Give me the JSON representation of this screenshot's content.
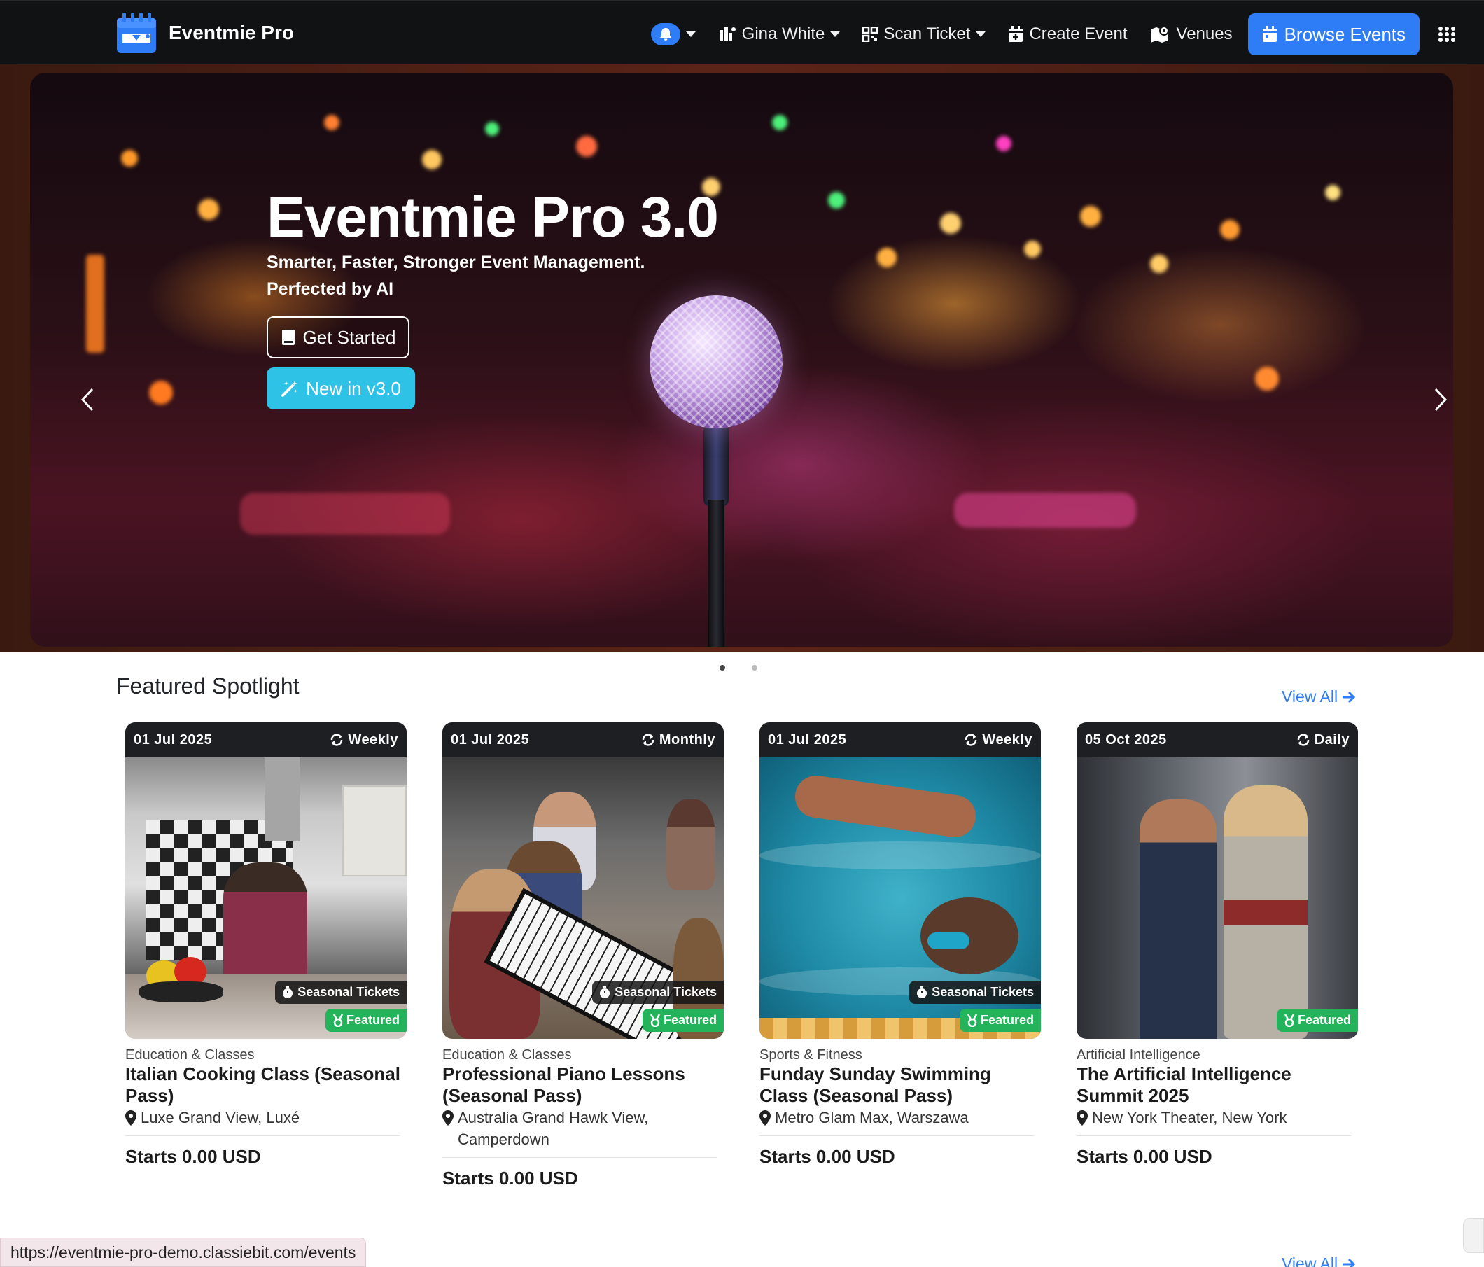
{
  "app": {
    "brand_name": "Eventmie Pro"
  },
  "nav": {
    "user_label": "Gina White",
    "scan_label": "Scan Ticket",
    "create_label": "Create Event",
    "venues_label": "Venues",
    "browse_label": "Browse Events"
  },
  "hero": {
    "title": "Eventmie Pro 3.0",
    "subtitle": "Smarter, Faster, Stronger Event Management. Perfected by AI",
    "get_started_label": "Get Started",
    "new_label": "New in v3.0",
    "slides_total": 2,
    "active_slide": 1
  },
  "featured": {
    "title": "Featured Spotlight",
    "view_all_label": "View All",
    "cards": [
      {
        "date": "01 Jul 2025",
        "frequency": "Weekly",
        "season_badge": "Seasonal Tickets",
        "featured_badge": "Featured",
        "category": "Education & Classes",
        "title": "Italian Cooking Class (Seasonal Pass)",
        "venue": "Luxe Grand View, Luxé",
        "price": "Starts 0.00 USD"
      },
      {
        "date": "01 Jul 2025",
        "frequency": "Monthly",
        "season_badge": "Seasonal Tickets",
        "featured_badge": "Featured",
        "category": "Education & Classes",
        "title": "Professional Piano Lessons (Seasonal Pass)",
        "venue": "Australia Grand Hawk View, Camperdown",
        "price": "Starts 0.00 USD"
      },
      {
        "date": "01 Jul 2025",
        "frequency": "Weekly",
        "season_badge": "Seasonal Tickets",
        "featured_badge": "Featured",
        "category": "Sports & Fitness",
        "title": "Funday Sunday Swimming Class (Seasonal Pass)",
        "venue": "Metro Glam Max, Warszawa",
        "price": "Starts 0.00 USD"
      },
      {
        "date": "05 Oct 2025",
        "frequency": "Daily",
        "featured_badge": "Featured",
        "category": "Artificial Intelligence",
        "title": "The Artificial Intelligence Summit 2025",
        "venue": "New York Theater, New York",
        "price": "Starts 0.00 USD"
      }
    ]
  },
  "status_bar": {
    "url": "https://eventmie-pro-demo.classiebit.com/events"
  },
  "colors": {
    "primary": "#2f7df6",
    "info": "#2ec3e6",
    "success": "#22b35b",
    "navbar": "#111214"
  },
  "icons": [
    "bell-icon",
    "user-icon",
    "qr-icon",
    "calendar-plus-icon",
    "map-icon",
    "calendar-icon",
    "apps-grid-icon",
    "book-icon",
    "magic-wand-icon",
    "repeat-icon",
    "stopwatch-icon",
    "medal-icon",
    "map-pin-icon",
    "arrow-right-icon",
    "chevron-left-icon",
    "chevron-right-icon"
  ]
}
